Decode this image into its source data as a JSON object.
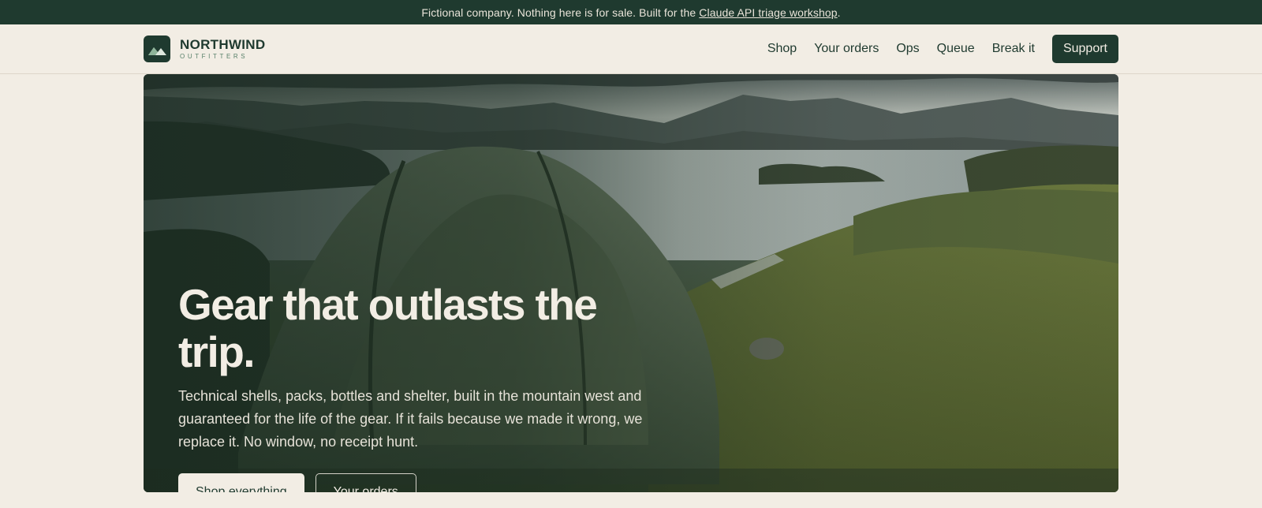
{
  "announcement": {
    "text": "Fictional company. Nothing here is for sale. Built for the",
    "link_text": "Claude API triage workshop",
    "suffix": "."
  },
  "brand": {
    "name": "NORTHWIND",
    "tagline": "OUTFITTERS",
    "logo_icon": "mountain-icon",
    "colors": {
      "primary": "#1f3a2f",
      "background": "#f2ede4",
      "accent": "#58806a"
    }
  },
  "nav": {
    "items": [
      {
        "label": "Shop"
      },
      {
        "label": "Your orders"
      },
      {
        "label": "Ops"
      },
      {
        "label": "Queue"
      },
      {
        "label": "Break it"
      }
    ],
    "support_label": "Support"
  },
  "hero": {
    "title": "Gear that outlasts the trip.",
    "body": "Technical shells, packs, bottles and shelter, built in the mountain west and guaranteed for the life of the gear. If it fails because we made it wrong, we replace it. No window, no receipt hunt.",
    "primary_cta": "Shop everything",
    "secondary_cta": "Your orders"
  }
}
